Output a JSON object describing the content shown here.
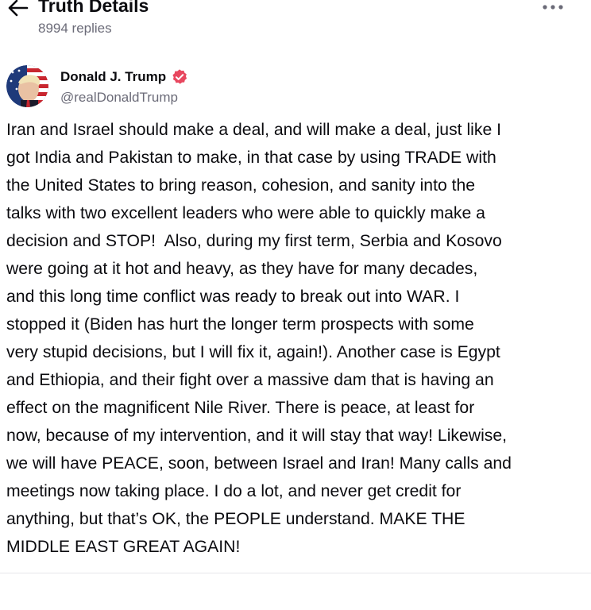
{
  "header": {
    "title": "Truth Details",
    "replies": "8994 replies",
    "back_icon": "arrow-left-icon",
    "more_icon": "ellipsis-icon"
  },
  "author": {
    "name": "Donald J. Trump",
    "handle": "@realDonaldTrump",
    "verified_icon": "verified-badge-icon",
    "verified_color": "#e8475f"
  },
  "post": {
    "text": "Iran and Israel should make a deal, and will make a deal, just like I\ngot India and Pakistan to make, in that case by using TRADE with\nthe United States to bring reason, cohesion, and sanity into the\ntalks with two excellent leaders who were able to quickly make a\ndecision and STOP!  Also, during my first term, Serbia and Kosovo\nwere going at it hot and heavy, as they have for many decades,\nand this long time conflict was ready to break out into WAR. I\nstopped it (Biden has hurt the longer term prospects with some\nvery stupid decisions, but I will fix it, again!). Another case is Egypt\nand Ethiopia, and their fight over a massive dam that is having an\neffect on the magnificent Nile River. There is peace, at least for\nnow, because of my intervention, and it will stay that way! Likewise,\nwe will have PEACE, soon, between Israel and Iran! Many calls and\nmeetings now taking place. I do a lot, and never get credit for\nanything, but that’s OK, the PEOPLE understand. MAKE THE\nMIDDLE EAST GREAT AGAIN!"
  }
}
